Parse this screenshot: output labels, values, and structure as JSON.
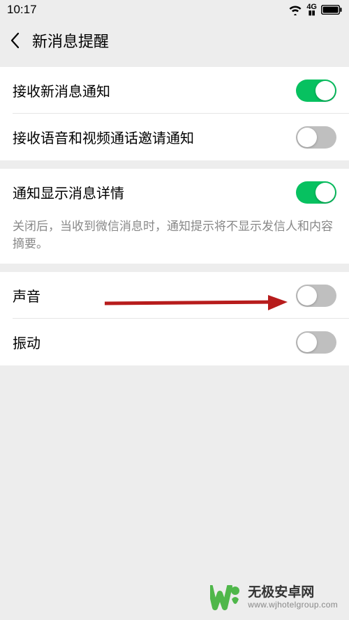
{
  "status": {
    "time": "10:17",
    "network": "4G"
  },
  "header": {
    "title": "新消息提醒"
  },
  "groups": [
    {
      "rows": [
        {
          "label": "接收新消息通知",
          "toggle": true
        },
        {
          "label": "接收语音和视频通话邀请通知",
          "toggle": false
        }
      ]
    },
    {
      "rows": [
        {
          "label": "通知显示消息详情",
          "toggle": true
        }
      ],
      "desc": "关闭后，当收到微信消息时，通知提示将不显示发信人和内容摘要。"
    },
    {
      "rows": [
        {
          "label": "声音",
          "toggle": false
        },
        {
          "label": "振动",
          "toggle": false
        }
      ]
    }
  ],
  "watermark": {
    "title": "无极安卓网",
    "url": "www.wjhotelgroup.com"
  }
}
